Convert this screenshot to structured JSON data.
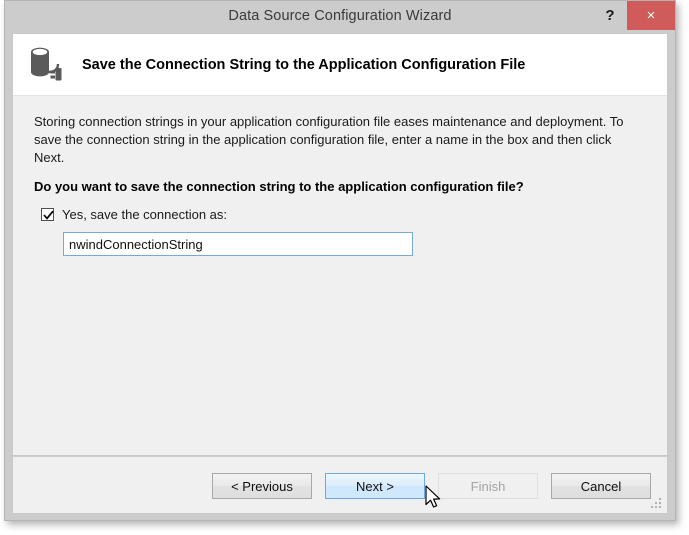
{
  "window": {
    "title": "Data Source Configuration Wizard",
    "help_label": "?",
    "close_label": "×"
  },
  "header": {
    "title": "Save the Connection String to the Application Configuration File",
    "icon": "database-connection-icon"
  },
  "body": {
    "intro": "Storing connection strings in your application configuration file eases maintenance and deployment. To save the connection string in the application configuration file, enter a name in the box and then click Next.",
    "question": "Do you want to save the connection string to the application configuration file?",
    "checkbox": {
      "label": "Yes, save the connection as:",
      "checked": true
    },
    "connection_name_input": {
      "value": "nwindConnectionString",
      "placeholder": ""
    }
  },
  "footer": {
    "buttons": [
      {
        "label": "< Previous",
        "state": "normal"
      },
      {
        "label": "Next >",
        "state": "hover"
      },
      {
        "label": "Finish",
        "state": "disabled"
      },
      {
        "label": "Cancel",
        "state": "normal"
      }
    ]
  },
  "colors": {
    "close_button": "#d05b5b",
    "titlebar": "#cccccc",
    "body_background": "#f0f0f0",
    "input_border": "#7aa8d4",
    "hover_border": "#6fa8da"
  }
}
